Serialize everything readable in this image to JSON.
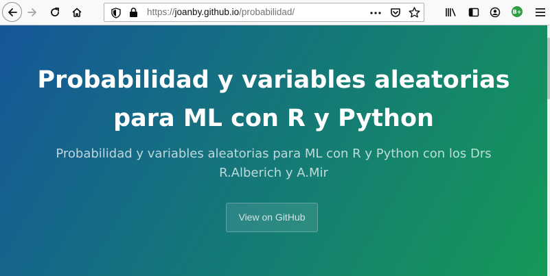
{
  "browser": {
    "url_prefix": "https://",
    "url_host": "joanby.github.io",
    "url_path": "/probabilidad/",
    "account_badge": "B+"
  },
  "hero": {
    "title": "Probabilidad y variables aleatorias para ML con R y Python",
    "tagline": "Probabilidad y variables aleatorias para ML con R y Python con los Drs R.Alberich y A.Mir",
    "button_label": "View on GitHub"
  },
  "colors": {
    "gradient_start": "#155799",
    "gradient_end": "#159957"
  }
}
